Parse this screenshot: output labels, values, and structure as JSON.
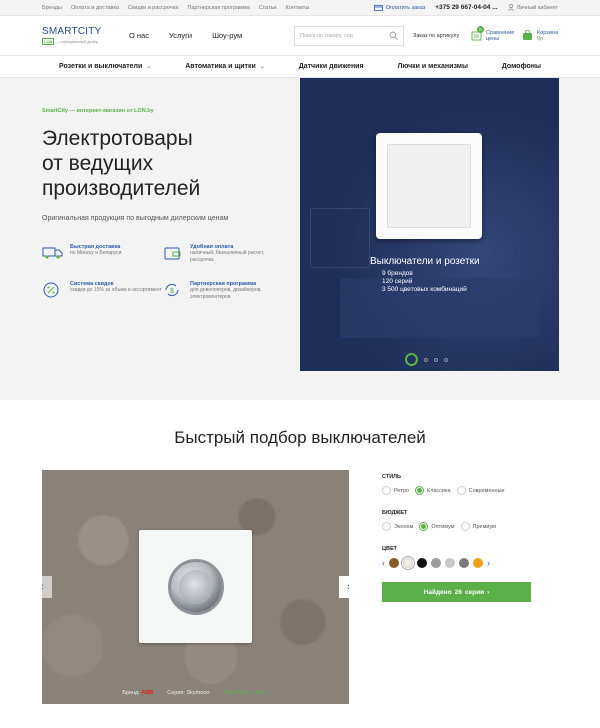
{
  "topbar": {
    "links": [
      "Бренды",
      "Оплата и доставка",
      "Скидки и рассрочка",
      "Партнерская программа",
      "Статьи",
      "Контакты"
    ],
    "pay_label": "Оплатить заказ",
    "phone": "+375 29 667-04-04",
    "phone_more": "...",
    "cabinet_label": "Личный кабинет"
  },
  "header": {
    "logo_name": "SMARTCITY",
    "logo_badge": "LON",
    "logo_sub": "— официальный дилер",
    "nav": [
      "О нас",
      "Услуги",
      "Шоу-рум"
    ],
    "search_placeholder": "Поиск по товару, сер",
    "order_by_article": "Заказ по артикулу",
    "compare_label": "Сравнение цены",
    "compare_count": "0",
    "cart_label": "Корзина",
    "cart_sub": "0р."
  },
  "catnav": [
    {
      "label": "Розетки и выключатели",
      "chevron": true
    },
    {
      "label": "Автоматика и щитки",
      "chevron": true
    },
    {
      "label": "Датчики движения",
      "chevron": false
    },
    {
      "label": "Лючки и механизмы",
      "chevron": false
    },
    {
      "label": "Домофоны",
      "chevron": false
    }
  ],
  "hero": {
    "kicker": "SmartCity — интернет-магазин от LON.by",
    "title_lines": [
      "Электротовары",
      "от ведущих",
      "производителей"
    ],
    "lead": "Оригинальная продукция по выгодным дилерским ценам",
    "features": [
      {
        "icon": "truck-icon",
        "title": "Быстрая доставка",
        "desc": "по Минску и Беларуси"
      },
      {
        "icon": "wallet-icon",
        "title": "Удобная оплата",
        "desc": "наличный, безналичный расчет, рассрочка"
      },
      {
        "icon": "percent-icon",
        "title": "Система скидок",
        "desc": "скидки до 15% за объем и ассортимент"
      },
      {
        "icon": "partner-icon",
        "title": "Партнерская программа",
        "desc": "для девелоперов, дизайнеров, электромонтеров"
      }
    ]
  },
  "banner": {
    "title": "Выключатели и розетки",
    "lines": [
      "9 брендов",
      "120 серий",
      "3 500 цветовых комбинаций"
    ],
    "slides": 4,
    "active_slide": 1
  },
  "quick": {
    "title": "Быстрый подбор выключателей",
    "caption_brand_label": "Бренд:",
    "caption_brand": "ABB",
    "caption_series": "Серия: Skymoon",
    "caption_link": "Подобрать серию",
    "style_label": "СТИЛЬ",
    "style_options": [
      "Ретро",
      "Классика",
      "Современные"
    ],
    "style_selected": 1,
    "budget_label": "БЮДЖЕТ",
    "budget_options": [
      "Эконом",
      "Оптимум",
      "Премиум"
    ],
    "budget_selected": 1,
    "color_label": "ЦВЕТ",
    "colors": [
      "#8a5a2b",
      "#f5f0e6",
      "#111111",
      "#9c9c9c",
      "#c8c8c8",
      "#7a7a7a",
      "#f2a01a"
    ],
    "color_selected": 1,
    "cta_prefix": "Найдено",
    "cta_count": "26",
    "cta_suffix": "серии"
  }
}
